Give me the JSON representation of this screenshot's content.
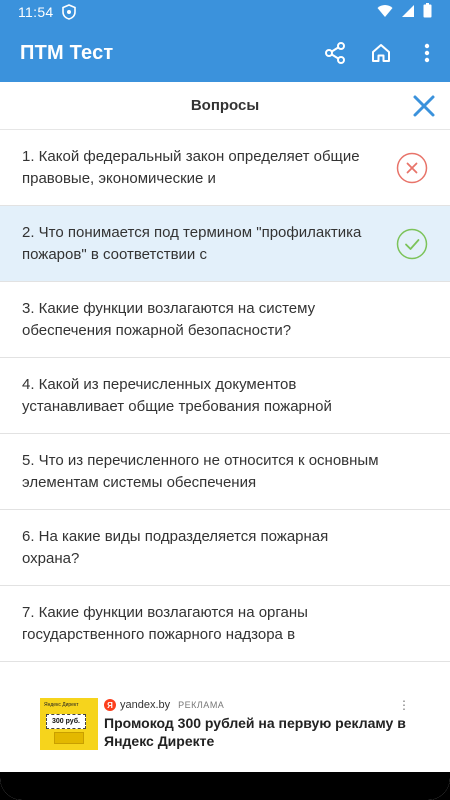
{
  "status_bar": {
    "time": "11:54",
    "icons": [
      "shield-icon",
      "wifi-icon",
      "signal-icon",
      "battery-icon"
    ]
  },
  "app_bar": {
    "title": "ПТМ Тест",
    "background": "#3b92dc",
    "actions": [
      "share-icon",
      "home-icon",
      "more-vert-icon"
    ]
  },
  "dialog": {
    "title": "Вопросы",
    "close_icon": "close-icon",
    "accent": "#3b92dc"
  },
  "questions": [
    {
      "text": "1. Какой федеральный закон определяет общие правовые, экономические и",
      "status": "wrong"
    },
    {
      "text": "2. Что понимается под термином \"профилактика пожаров\" в соответствии с",
      "status": "correct",
      "selected": true
    },
    {
      "text": "3. Какие функции возлагаются на систему обеспечения пожарной безопасности?",
      "status": "none"
    },
    {
      "text": "4. Какой из перечисленных документов устанавливает общие требования пожарной",
      "status": "none"
    },
    {
      "text": "5. Что из перечисленного не относится к основным элементам системы обеспечения",
      "status": "none"
    },
    {
      "text": "6. На какие виды подразделяется пожарная охрана?",
      "status": "none"
    },
    {
      "text": "7. Какие функции возлагаются на органы государственного пожарного надзора в",
      "status": "none"
    }
  ],
  "status_colors": {
    "wrong": "#e8746a",
    "correct": "#7cc35a"
  },
  "ad": {
    "domain": "yandex.by",
    "label": "РЕКЛАМА",
    "ya_letter": "Я",
    "headline": "Промокод 300 рублей на первую рекламу в Яндекс Директе",
    "image_title": "Яндекс Директ",
    "image_price": "300 руб."
  }
}
